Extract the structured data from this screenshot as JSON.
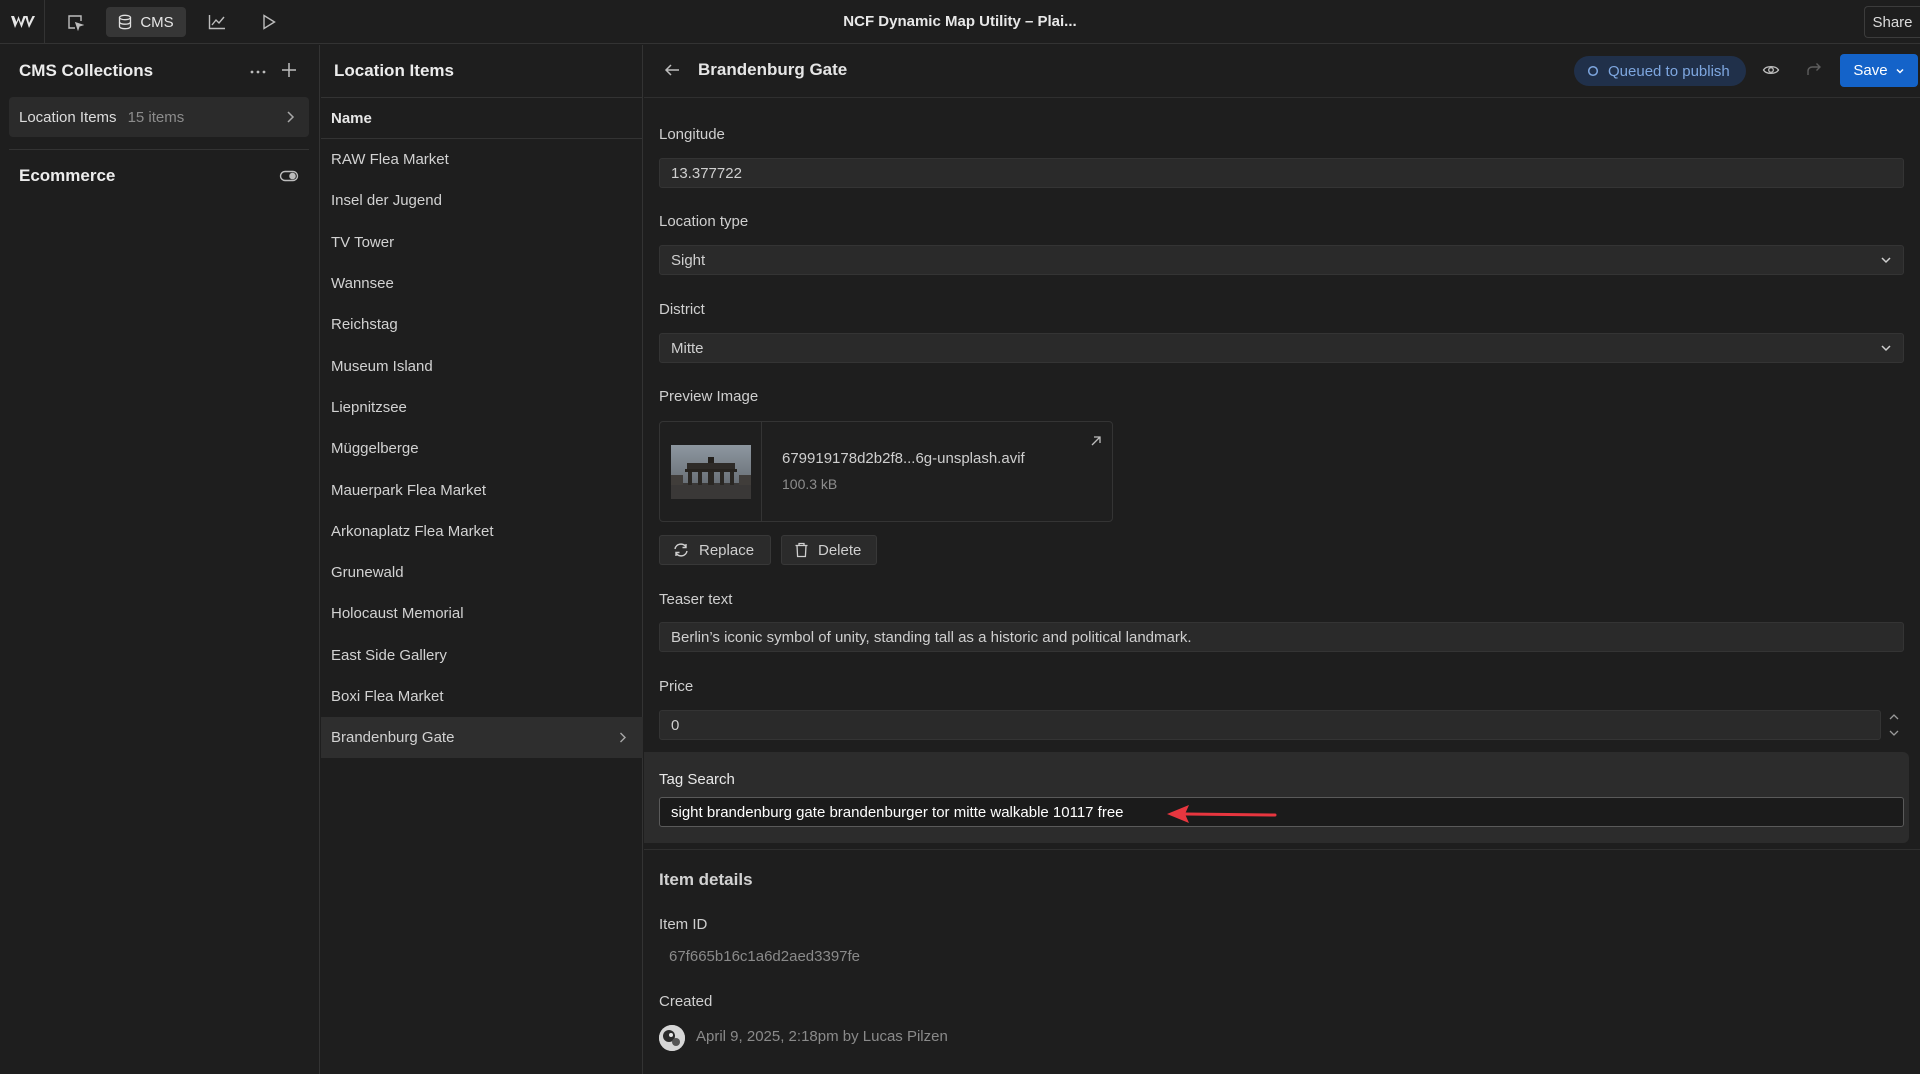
{
  "topbar": {
    "title": "NCF Dynamic Map Utility – Plai...",
    "cms_label": "CMS",
    "share_label": "Share"
  },
  "sidebar": {
    "title": "CMS Collections",
    "collection": {
      "label": "Location Items",
      "count": "15 items"
    },
    "ecommerce_label": "Ecommerce"
  },
  "list": {
    "title": "Location Items",
    "column_header": "Name",
    "items": [
      "RAW Flea Market",
      "Insel der Jugend",
      "TV Tower",
      "Wannsee",
      "Reichstag",
      "Museum Island",
      "Liepnitzsee",
      "Müggelberge",
      "Mauerpark Flea Market",
      "Arkonaplatz Flea Market",
      "Grunewald",
      "Holocaust Memorial",
      "East Side Gallery",
      "Boxi Flea Market",
      "Brandenburg Gate"
    ],
    "selected": "Brandenburg Gate"
  },
  "detail": {
    "title": "Brandenburg Gate",
    "status": "Queued to publish",
    "save_label": "Save",
    "fields": {
      "longitude": {
        "label": "Longitude",
        "value": "13.377722"
      },
      "location_type": {
        "label": "Location type",
        "value": "Sight"
      },
      "district": {
        "label": "District",
        "value": "Mitte"
      },
      "preview_image": {
        "label": "Preview Image",
        "filename": "679919178d2b2f8...6g-unsplash.avif",
        "size": "100.3 kB",
        "replace_label": "Replace",
        "delete_label": "Delete"
      },
      "teaser": {
        "label": "Teaser text",
        "value": "Berlin’s iconic symbol of unity, standing tall as a historic and political landmark."
      },
      "price": {
        "label": "Price",
        "value": "0"
      },
      "tag_search": {
        "label": "Tag Search",
        "value": "sight brandenburg gate brandenburger tor mitte walkable 10117 free"
      }
    },
    "item_details": {
      "title": "Item details",
      "item_id_label": "Item ID",
      "item_id": "67f665b16c1a6d2aed3397fe",
      "created_label": "Created",
      "created_value": "April 9, 2025, 2:18pm by Lucas Pilzen"
    }
  },
  "colors": {
    "accent": "#1463c9",
    "status_bg": "#20304a",
    "status_text": "#7ea7e0",
    "annotation_arrow": "#e8363f"
  },
  "icons": [
    "webflow-logo",
    "navigator-icon",
    "database-icon",
    "chart-icon",
    "play-icon",
    "more-icon",
    "plus-icon",
    "chevron-right-icon",
    "toggle-icon",
    "back-arrow-icon",
    "status-circle-icon",
    "eye-icon",
    "redo-icon",
    "chevron-down-icon",
    "external-link-icon",
    "refresh-icon",
    "trash-icon",
    "stepper-icon",
    "avatar"
  ]
}
